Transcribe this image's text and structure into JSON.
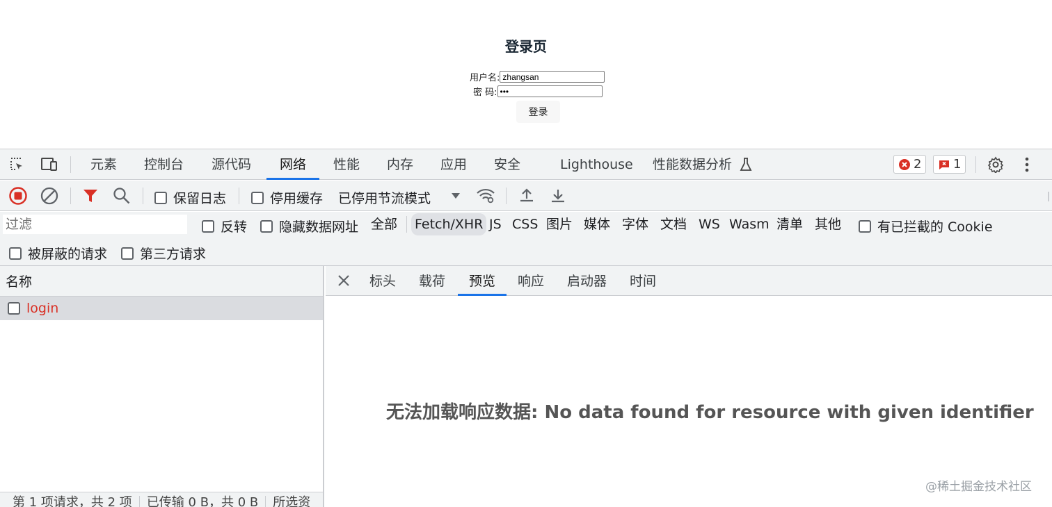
{
  "page": {
    "title": "登录页",
    "username_label": "用户名:",
    "username_value": "zhangsan",
    "password_label": "密 码:",
    "password_value": "•••",
    "login_button": "登录"
  },
  "devtools": {
    "tabs": [
      {
        "label": "元素"
      },
      {
        "label": "控制台"
      },
      {
        "label": "源代码"
      },
      {
        "label": "网络",
        "active": true
      },
      {
        "label": "性能"
      },
      {
        "label": "内存"
      },
      {
        "label": "应用"
      },
      {
        "label": "安全"
      },
      {
        "label": "Lighthouse"
      },
      {
        "label": "性能数据分析"
      }
    ],
    "error_count": "2",
    "issue_count": "1",
    "toolbar": {
      "preserve_log": "保留日志",
      "disable_cache": "停用缓存",
      "throttling": "已停用节流模式"
    },
    "filter": {
      "placeholder": "过滤",
      "invert": "反转",
      "hide_data_urls": "隐藏数据网址",
      "types": [
        "全部",
        "Fetch/XHR",
        "JS",
        "CSS",
        "图片",
        "媒体",
        "字体",
        "文档",
        "WS",
        "Wasm",
        "清单",
        "其他"
      ],
      "active_type": "Fetch/XHR",
      "blocked_cookies": "有已拦截的 Cookie",
      "blocked_requests": "被屏蔽的请求",
      "third_party": "第三方请求"
    },
    "requests": {
      "column_name": "名称",
      "rows": [
        {
          "name": "login"
        }
      ]
    },
    "status_bar": {
      "requests": "第 1 项请求，共 2 项",
      "transferred": "已传输 0 B，共 0 B",
      "selected": "所选资"
    },
    "detail": {
      "tabs": [
        {
          "label": "标头"
        },
        {
          "label": "载荷"
        },
        {
          "label": "预览",
          "active": true
        },
        {
          "label": "响应"
        },
        {
          "label": "启动器"
        },
        {
          "label": "时间"
        }
      ],
      "message": "无法加载响应数据: No data found for resource with given identifier"
    },
    "watermark": "@稀土掘金技术社区"
  }
}
